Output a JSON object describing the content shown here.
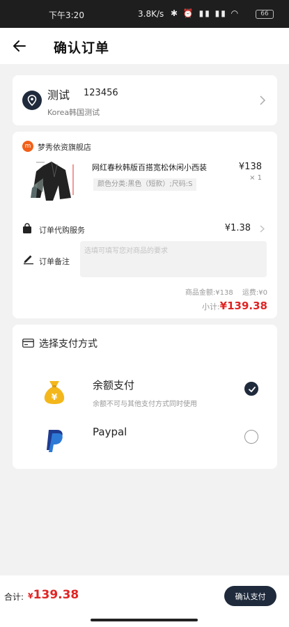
{
  "status_bar": {
    "time": "下午3:20",
    "network_speed": "3.8K/s",
    "battery": "66"
  },
  "header": {
    "title": "确认订单",
    "back_icon": "arrow-left-icon"
  },
  "address": {
    "name": "测试",
    "phone": "123456",
    "line": "Korea韩国测试"
  },
  "order": {
    "shop_name": "梦秀依资旗舰店",
    "shop_icon_text": "m",
    "product": {
      "title": "网红春秋韩版百搭宽松休闲小西装",
      "sku": "颜色分类:黑色（短款）;尺码:S",
      "price": "¥138",
      "quantity": "× 1"
    },
    "service": {
      "label": "订单代购服务",
      "price": "¥1.38"
    },
    "note": {
      "label": "订单备注",
      "placeholder": "选填可填写您对商品的要求",
      "value": ""
    },
    "goods_amount": "商品金额:¥138",
    "shipping": "运费:¥0",
    "subtotal_label": "小计:",
    "subtotal_value": "¥139.38"
  },
  "payment": {
    "title": "选择支付方式",
    "options": [
      {
        "name": "余额支付",
        "subtitle": "余额不可与其他支付方式同时使用",
        "selected": true,
        "icon": "money-bag-icon"
      },
      {
        "name": "Paypal",
        "subtitle": "",
        "selected": false,
        "icon": "paypal-icon"
      }
    ]
  },
  "footer": {
    "total_label": "合计:",
    "total_currency": "¥",
    "total_value": "139.38",
    "confirm_label": "确认支付"
  },
  "colors": {
    "accent": "#1f2a3c",
    "price_red": "#e02424",
    "shop_orange": "#f2601a",
    "background": "#f2f2f2"
  }
}
